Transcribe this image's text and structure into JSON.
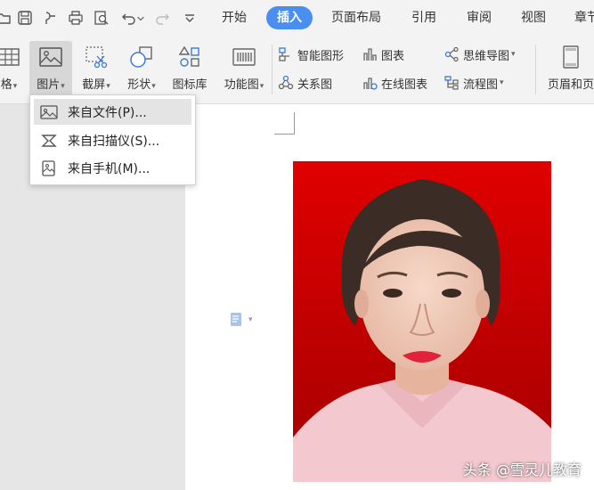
{
  "tabs": [
    {
      "label": "开始",
      "active": false
    },
    {
      "label": "插入",
      "active": true
    },
    {
      "label": "页面布局",
      "active": false
    },
    {
      "label": "引用",
      "active": false
    },
    {
      "label": "审阅",
      "active": false
    },
    {
      "label": "视图",
      "active": false
    },
    {
      "label": "章节",
      "active": false
    }
  ],
  "ribbon": {
    "table_label": "格",
    "picture_label": "图片",
    "screenshot_label": "截屏",
    "shape_label": "形状",
    "iconlib_label": "图标库",
    "function_chart_label": "功能图",
    "smartart_label": "智能图形",
    "chart_label": "图表",
    "mindmap_label": "思维导图",
    "relation_label": "关系图",
    "online_chart_label": "在线图表",
    "flowchart_label": "流程图",
    "header_footer_label": "页眉和页"
  },
  "picture_menu": {
    "items": [
      {
        "label": "来自文件(P)...",
        "icon": "image-file-icon"
      },
      {
        "label": "来自扫描仪(S)...",
        "icon": "scanner-icon"
      },
      {
        "label": "来自手机(M)...",
        "icon": "phone-image-icon"
      }
    ]
  },
  "watermark": "头条 @雪灵儿教育",
  "colors": {
    "accent": "#4a8ff0",
    "photo_background": "#cc0000",
    "ribbon_bg": "#f3f3f3"
  }
}
